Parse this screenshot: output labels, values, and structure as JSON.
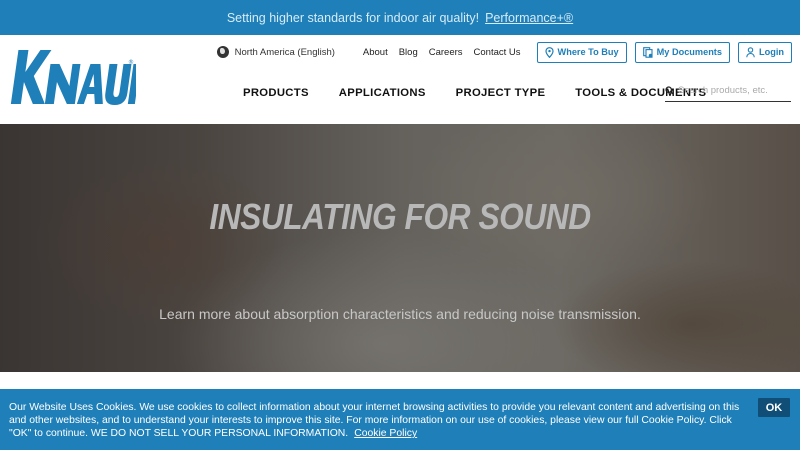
{
  "banner": {
    "text": "Setting higher standards for indoor air quality!",
    "link": "Performance+®"
  },
  "logo": {
    "text": "KNAUF",
    "color": "#1f7fb8"
  },
  "utility_nav": {
    "region": "North America (English)",
    "links": [
      "About",
      "Blog",
      "Careers",
      "Contact Us"
    ],
    "buttons": [
      {
        "label": "Where To Buy",
        "icon": "map-pin-icon"
      },
      {
        "label": "My Documents",
        "icon": "documents-icon"
      },
      {
        "label": "Login",
        "icon": "user-icon"
      }
    ]
  },
  "main_nav": [
    "PRODUCTS",
    "APPLICATIONS",
    "PROJECT TYPE",
    "TOOLS & DOCUMENTS"
  ],
  "search": {
    "placeholder": "Search products, etc."
  },
  "hero": {
    "title": "INSULATING FOR SOUND",
    "subtitle": "Learn more about absorption characteristics and reducing noise transmission."
  },
  "cookie": {
    "text": "Our Website Uses Cookies. We use cookies to collect information about your internet browsing activities to provide you relevant content and advertising on this and other websites, and to understand your interests to improve this site. For more information on our use of cookies, please view our full Cookie Policy. Click \"OK\" to continue. WE DO NOT SELL YOUR PERSONAL INFORMATION.",
    "link": "Cookie Policy",
    "ok_label": "OK"
  },
  "colors": {
    "brand_blue": "#1f7fb8",
    "ok_button": "#114e77"
  }
}
